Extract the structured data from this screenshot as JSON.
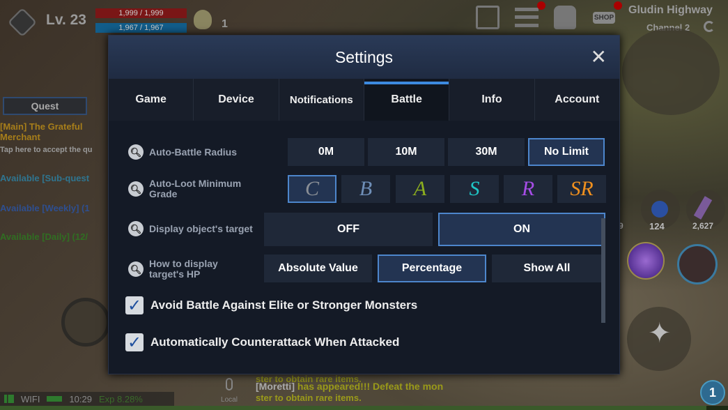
{
  "hud": {
    "level": "Lv. 23",
    "hp": "1,999 / 1,999",
    "mp": "1,967 / 1,967",
    "rank_count": "1",
    "hp_fill": 1.0,
    "mp_fill": 1.0
  },
  "location": {
    "zone": "Gludin Highway",
    "channel": "Channel 2"
  },
  "top_icons": [
    "quest-log-icon",
    "menu-icon",
    "bag-icon",
    "shop-icon"
  ],
  "shop_label": "SHOP",
  "quest_panel": {
    "title": "Quest",
    "items": [
      {
        "text": "[Main] The Grateful Merchant",
        "sub": "Tap here to accept the qu",
        "color": "#c8961c"
      },
      {
        "text": "Available [Sub-quest",
        "color": "#3b8fb0"
      },
      {
        "text": "Available [Weekly] (1",
        "color": "#3a63b0"
      },
      {
        "text": "Available [Daily] (12/",
        "color": "#3c8a2a"
      }
    ]
  },
  "items": {
    "potion_count": "124",
    "scroll_count": "2,627",
    "partial_count": "9"
  },
  "badge": "1",
  "chat": {
    "line1": "ster to obtain rare items.",
    "name": "[Moretti]",
    "msg": " has appeared!!! Defeat the mon",
    "msg2": "ster to obtain rare items.",
    "channel": "Local"
  },
  "status": {
    "network": "WIFI",
    "time": "10:29",
    "exp": "Exp 8.28%"
  },
  "settings": {
    "title": "Settings",
    "tabs": [
      "Game",
      "Device",
      "Notifications",
      "Battle",
      "Info",
      "Account"
    ],
    "active_tab": "Battle",
    "auto_battle_radius": {
      "label": "Auto-Battle Radius",
      "options": [
        "0M",
        "10M",
        "30M",
        "No Limit"
      ],
      "selected": "No Limit"
    },
    "auto_loot": {
      "label": "Auto-Loot Minimum Grade",
      "options": [
        "C",
        "B",
        "A",
        "S",
        "R",
        "SR"
      ],
      "colors": [
        "#8a8f96",
        "#6f8fb8",
        "#8cae1e",
        "#1fc6c6",
        "#a64de6",
        "#f0901e"
      ],
      "selected": "C"
    },
    "display_target": {
      "label": "Display object's target",
      "options": [
        "OFF",
        "ON"
      ],
      "selected": "ON"
    },
    "hp_display": {
      "label": "How to display target's HP",
      "options": [
        "Absolute Value",
        "Percentage",
        "Show All"
      ],
      "selected": "Percentage"
    },
    "checkboxes": [
      {
        "label": "Avoid Battle Against Elite or Stronger Monsters",
        "checked": true
      },
      {
        "label": "Automatically Counterattack When Attacked",
        "checked": true
      }
    ]
  }
}
